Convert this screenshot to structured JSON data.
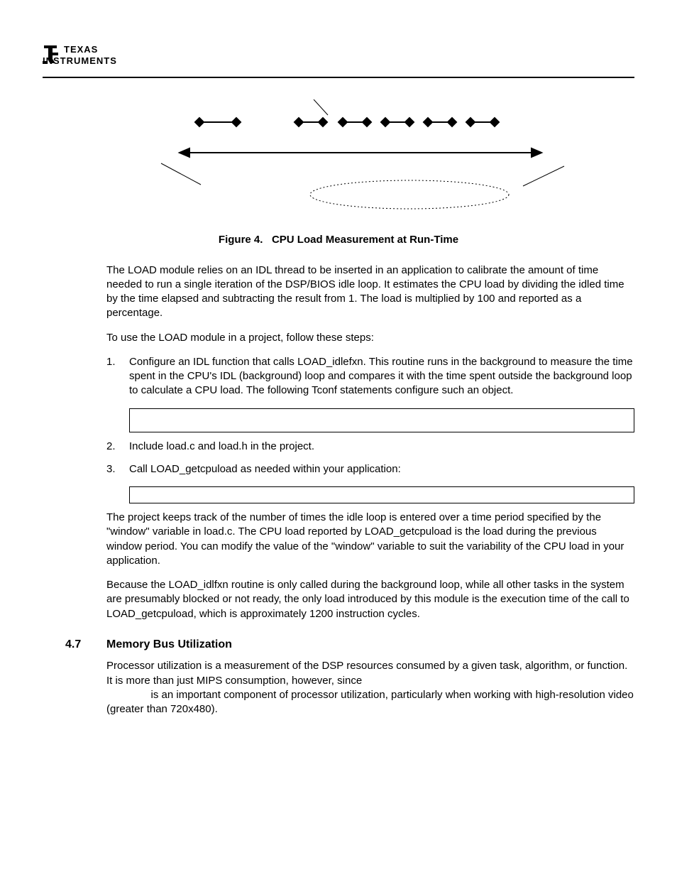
{
  "logo": {
    "line1": "TEXAS",
    "line2": "INSTRUMENTS"
  },
  "figure": {
    "label": "Figure 4.",
    "title": "CPU Load Measurement at Run-Time"
  },
  "para1": "The LOAD module relies on an IDL thread to be inserted in an application to calibrate the amount of time needed to run a single iteration of the DSP/BIOS idle loop. It estimates the CPU load by dividing the idled time by the time elapsed and subtracting the result from 1. The load is multiplied by 100 and reported as a percentage.",
  "para2": "To use the LOAD module in a project, follow these steps:",
  "steps": {
    "s1": "Configure an IDL function that calls LOAD_idlefxn. This routine runs in the background to measure the time spent in the CPU's IDL (background) loop and compares it with the time spent outside the background loop to calculate a CPU load. The following Tconf statements configure such an object.",
    "s2": "Include load.c and load.h in the project.",
    "s3": "Call LOAD_getcpuload as needed within your application:"
  },
  "para3": "The project keeps track of the number of times the idle loop is entered over a time period specified by the \"window\" variable in load.c. The CPU load reported by LOAD_getcpuload is the load during the previous window period. You can modify the value of the \"window\"  variable to suit the variability of the CPU load in your application.",
  "para4": "Because the LOAD_idlfxn routine is only called during the background loop, while all other tasks in the system are presumably blocked or not ready, the only load introduced by this module is the execution time of the call to LOAD_getcpuload, which is approximately 1200 instruction cycles.",
  "section": {
    "num": "4.7",
    "title": "Memory Bus Utilization"
  },
  "para5a": "Processor utilization is a measurement of the DSP resources consumed by a given task, algorithm, or function. It is more than just MIPS consumption, however, since ",
  "para5b": " is an important component of processor utilization, particularly when working with high-resolution video (greater than 720x480)."
}
